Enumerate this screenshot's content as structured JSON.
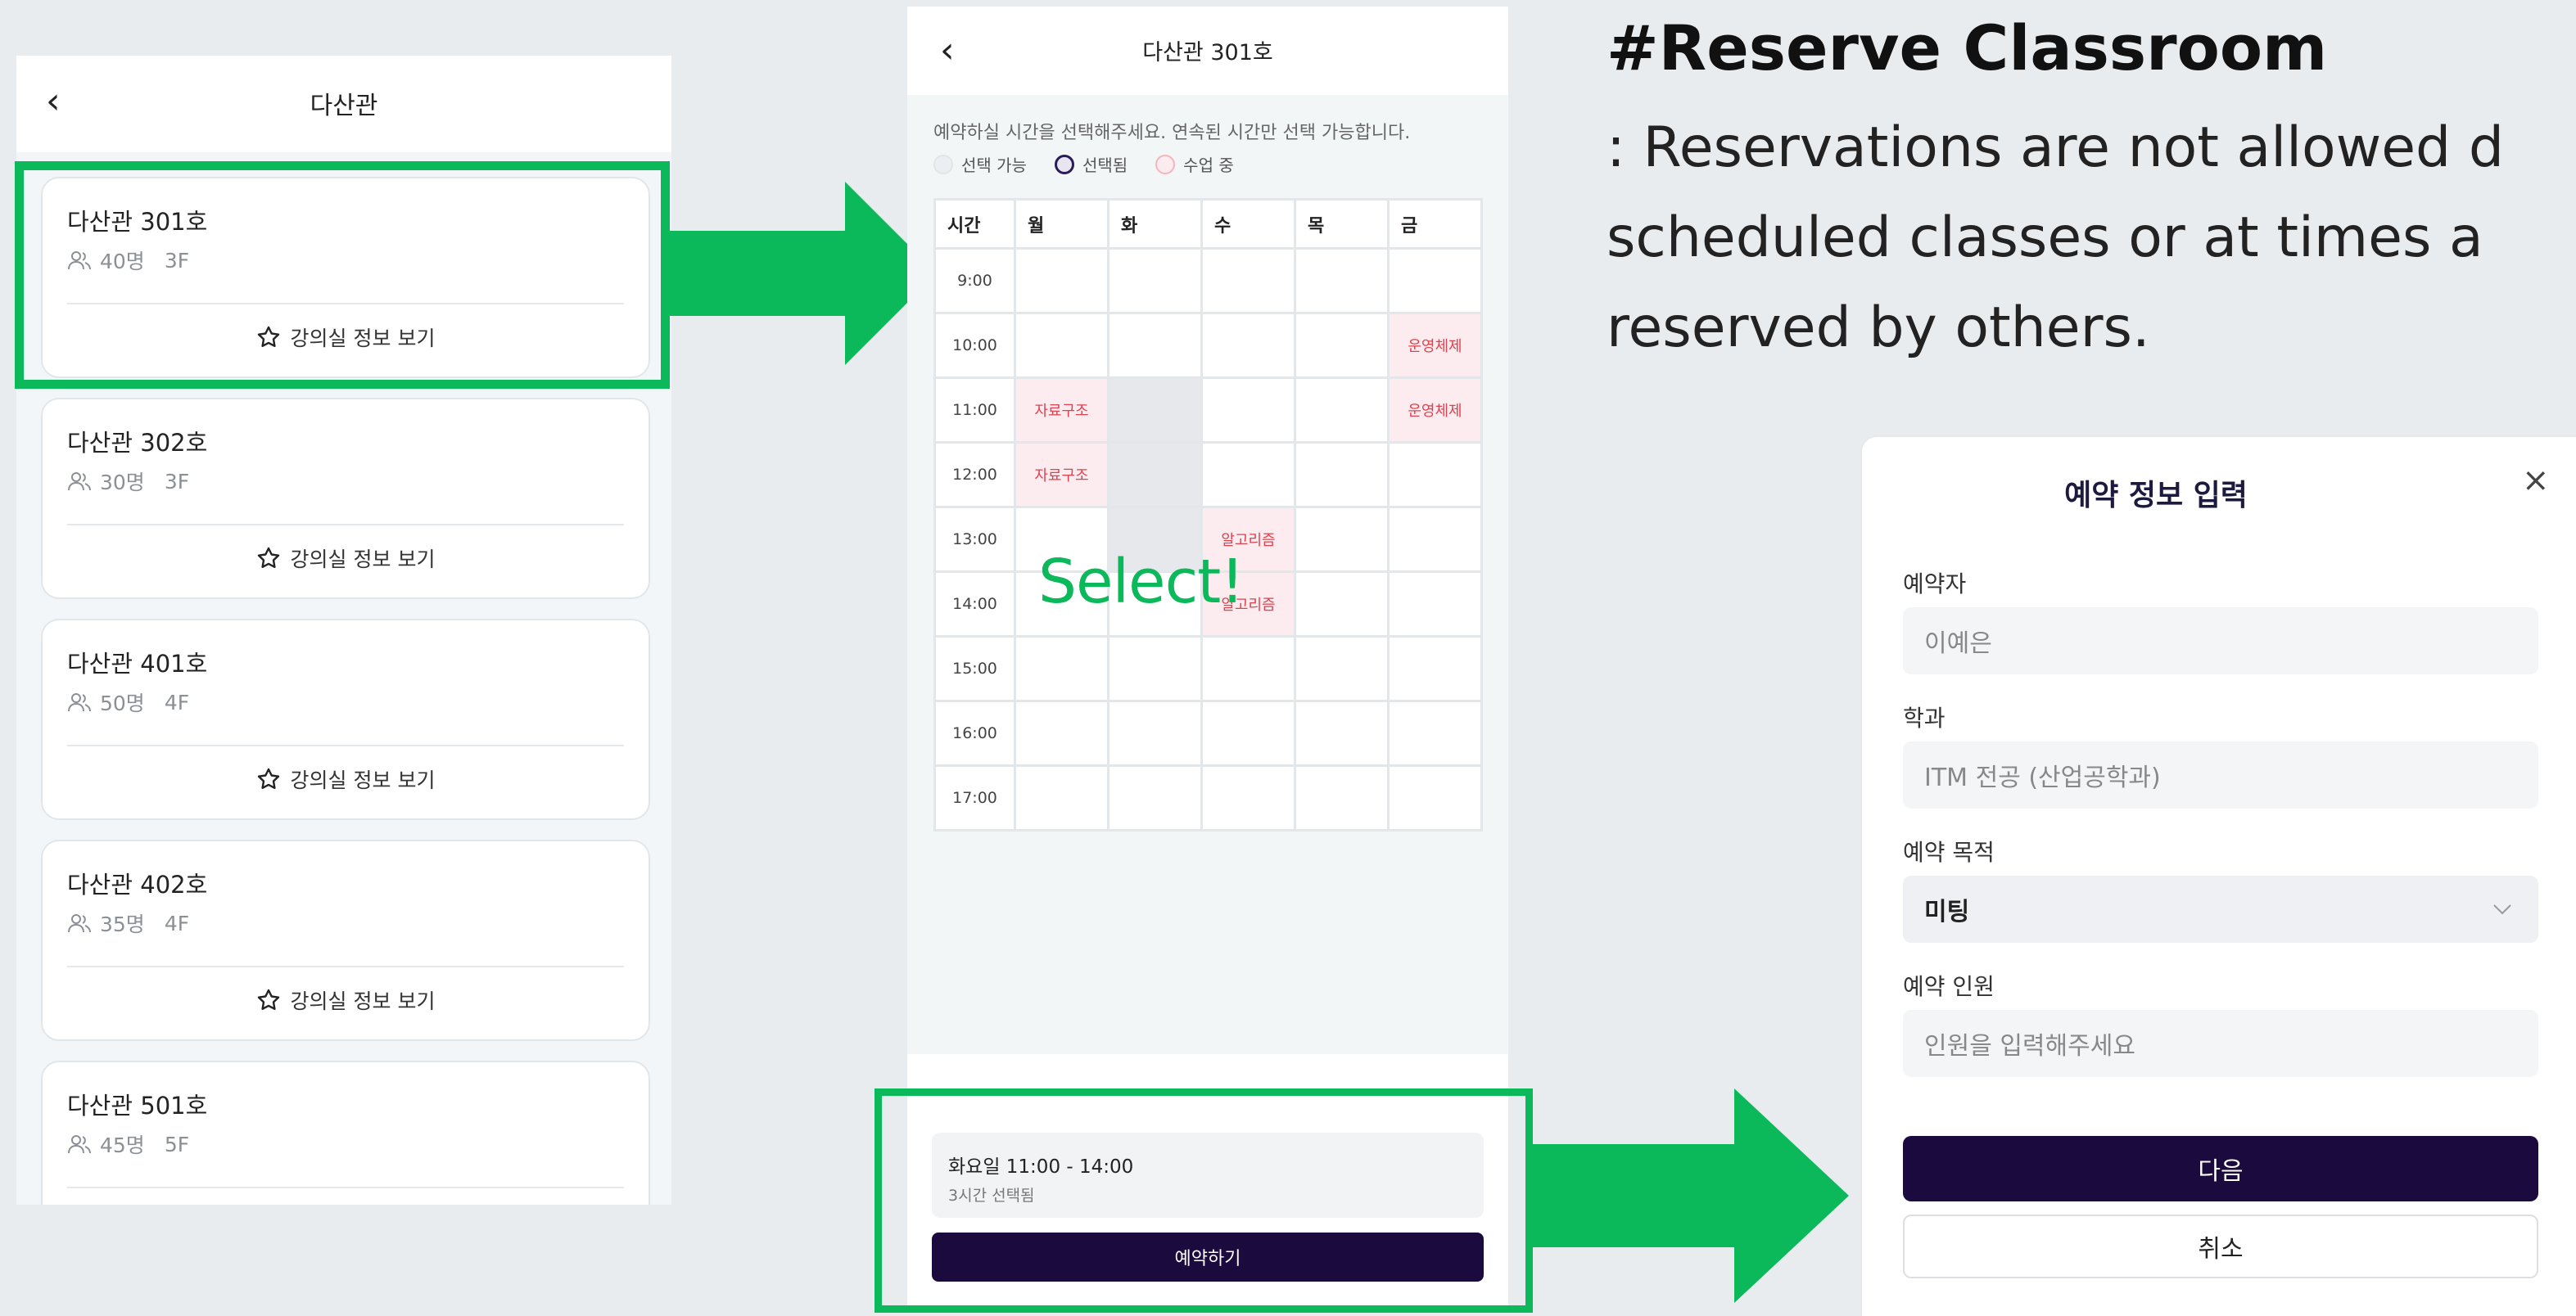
{
  "list_screen": {
    "title": "다산관",
    "rooms": [
      {
        "name": "다산관 301호",
        "capacity": "40명",
        "floor": "3F",
        "info_label": "강의실 정보 보기"
      },
      {
        "name": "다산관 302호",
        "capacity": "30명",
        "floor": "3F",
        "info_label": "강의실 정보 보기"
      },
      {
        "name": "다산관 401호",
        "capacity": "50명",
        "floor": "4F",
        "info_label": "강의실 정보 보기"
      },
      {
        "name": "다산관 402호",
        "capacity": "35명",
        "floor": "4F",
        "info_label": "강의실 정보 보기"
      },
      {
        "name": "다산관 501호",
        "capacity": "45명",
        "floor": "5F",
        "info_label": ""
      }
    ]
  },
  "timetable_screen": {
    "title": "다산관 301호",
    "instruction": "예약하실 시간을 선택해주세요. 연속된 시간만 선택 가능합니다.",
    "legend": {
      "available": "선택 가능",
      "selected": "선택됨",
      "in_class": "수업 중"
    },
    "columns": [
      "시간",
      "월",
      "화",
      "수",
      "목",
      "금"
    ],
    "times": [
      "9:00",
      "10:00",
      "11:00",
      "12:00",
      "13:00",
      "14:00",
      "15:00",
      "16:00",
      "17:00"
    ],
    "rows": [
      [
        "",
        "",
        "",
        "",
        ""
      ],
      [
        "",
        "",
        "",
        "",
        "운영체제"
      ],
      [
        "자료구조",
        "",
        "",
        "",
        "운영체제"
      ],
      [
        "자료구조",
        "",
        "",
        "",
        ""
      ],
      [
        "",
        "",
        "알고리즘",
        "",
        ""
      ],
      [
        "",
        "",
        "알고리즘",
        "",
        ""
      ],
      [
        "",
        "",
        "",
        "",
        ""
      ],
      [
        "",
        "",
        "",
        "",
        ""
      ],
      [
        "",
        "",
        "",
        "",
        ""
      ]
    ],
    "selection_summary": "화요일 11:00 - 14:00",
    "selection_sub": "3시간 선택됨",
    "reserve_button": "예약하기"
  },
  "annotation": {
    "select_label": "Select!",
    "heading": "#Reserve Classroom",
    "desc_lines": [
      ": Reservations are not allowed d",
      "scheduled classes or at times a",
      "reserved by others."
    ]
  },
  "form": {
    "title": "예약 정보 입력",
    "close": "×",
    "reserver_label": "예약자",
    "reserver_value": "이예은",
    "dept_label": "학과",
    "dept_value": "ITM 전공 (산업공학과)",
    "purpose_label": "예약 목적",
    "purpose_value": "미팅",
    "people_label": "예약 인원",
    "people_placeholder": "인원을 입력해주세요",
    "next_button": "다음",
    "cancel_button": "취소"
  },
  "colors": {
    "accent_green": "#0bb85a",
    "navy": "#1a0a3d",
    "class_red": "#e0414e"
  }
}
